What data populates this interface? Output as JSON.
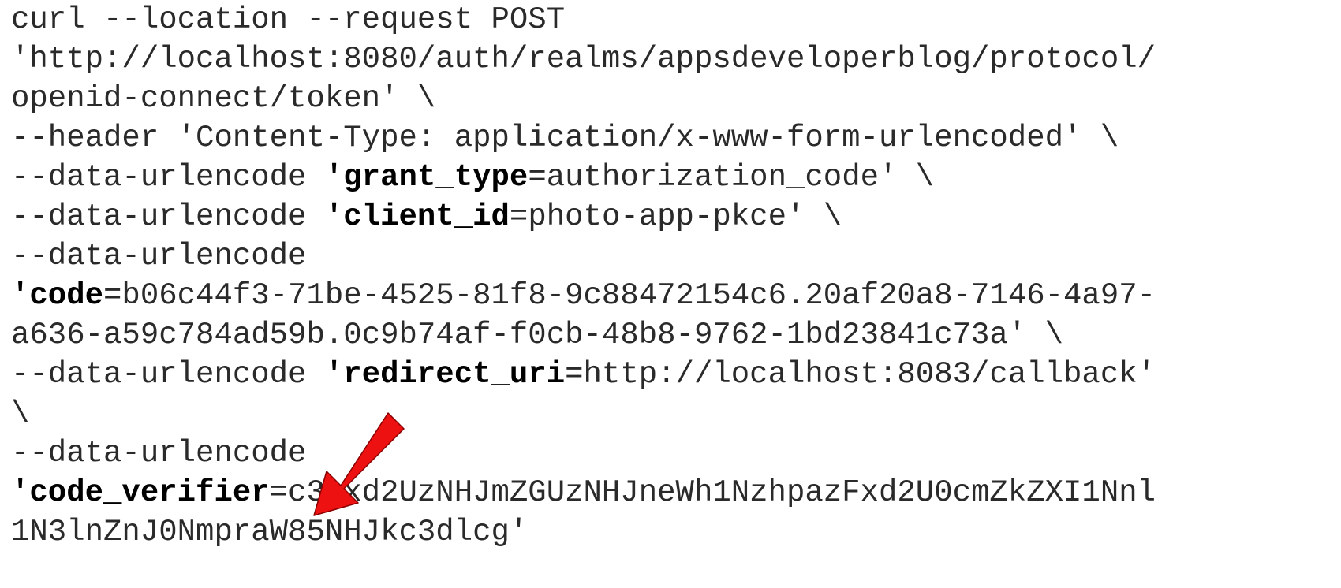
{
  "code": {
    "lines": [
      {
        "text": "curl --location --request POST"
      },
      {
        "text": "'http://localhost:8080/auth/realms/appsdeveloperblog/protocol/"
      },
      {
        "text": "openid-connect/token' \\"
      },
      {
        "text": "--header 'Content-Type: application/x-www-form-urlencoded' \\"
      },
      {
        "pre": "--data-urlencode ",
        "bold": "'grant_type",
        "post": "=authorization_code' \\"
      },
      {
        "pre": "--data-urlencode ",
        "bold": "'client_id",
        "post": "=photo-app-pkce' \\"
      },
      {
        "text": "--data-urlencode"
      },
      {
        "pre": "",
        "bold": "'code",
        "post": "=b06c44f3-71be-4525-81f8-9c88472154c6.20af20a8-7146-4a97-"
      },
      {
        "text": "a636-a59c784ad59b.0c9b74af-f0cb-48b8-9762-1bd23841c73a' \\"
      },
      {
        "pre": "--data-urlencode ",
        "bold": "'redirect_uri",
        "post": "=http://localhost:8083/callback'"
      },
      {
        "text": "\\"
      },
      {
        "text": "--data-urlencode"
      },
      {
        "pre": "",
        "bold": "'code_verifier",
        "post": "=c3cxd2UzNHJmZGUzNHJneWh1NzhpazFxd2U0cmZkZXI1Nnl"
      },
      {
        "text": "1N3lnZnJ0NmpraW85NHJkc3dlcg'"
      }
    ]
  },
  "annotation": {
    "arrow_color": "#ee1111",
    "arrow_icon": "red-arrow-icon"
  }
}
